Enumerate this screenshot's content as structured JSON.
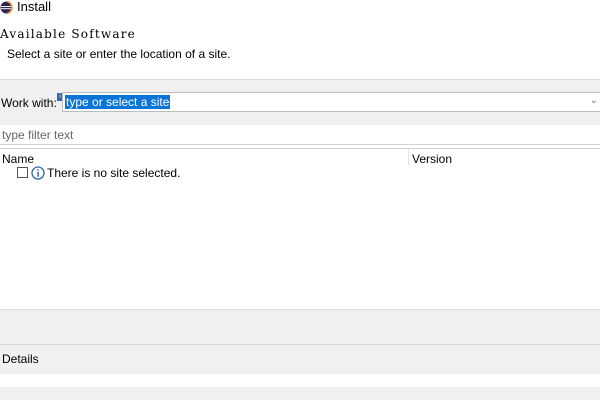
{
  "window": {
    "title": "Install",
    "icon": "eclipse-icon"
  },
  "page": {
    "title": "Available Software",
    "description": "Select a site or enter the location of a site."
  },
  "work_with": {
    "label": "Work with:",
    "value": "type or select a site",
    "dropdown_icon": "chevron-down-icon"
  },
  "filter": {
    "placeholder": "type filter text"
  },
  "table": {
    "columns": [
      "Name",
      "Version"
    ],
    "rows": [
      {
        "checked": false,
        "icon": "info-icon",
        "name": "There is no site selected.",
        "version": ""
      }
    ]
  },
  "details": {
    "label": "Details"
  },
  "colors": {
    "selection": "#0a74d8",
    "panel": "#f0f0f0",
    "info": "#2d68b4"
  }
}
